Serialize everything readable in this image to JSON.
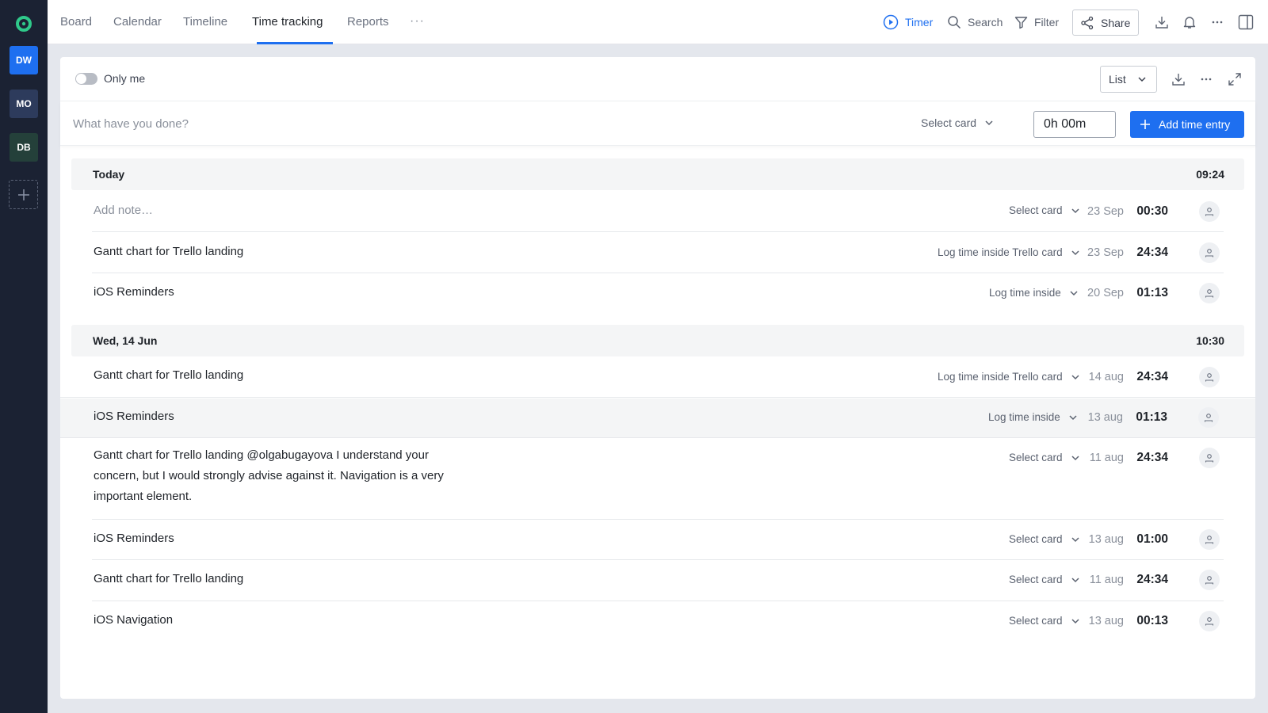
{
  "sidebar": {
    "workspaces": [
      {
        "initials": "DW",
        "color": "#1e6ff0"
      },
      {
        "initials": "MO",
        "color": "#2d3b5c"
      },
      {
        "initials": "DB",
        "color": "#24403a"
      }
    ]
  },
  "nav": {
    "tabs": [
      "Board",
      "Calendar",
      "Timeline",
      "Time tracking",
      "Reports"
    ],
    "active_tab": "Time tracking",
    "more": "···"
  },
  "topbar": {
    "timer_label": "Timer",
    "search_label": "Search",
    "filter_label": "Filter",
    "share_label": "Share"
  },
  "toolbar": {
    "only_me_label": "Only me",
    "view_mode": "List"
  },
  "entry": {
    "placeholder": "What have you done?",
    "select_card_label": "Select card",
    "duration_value": "0h 00m",
    "add_button_label": "Add time entry"
  },
  "groups": [
    {
      "title": "Today",
      "total": "09:24",
      "rows": [
        {
          "title": "Add note…",
          "card_select": "Select card",
          "date": "23 Sep",
          "duration": "00:30"
        },
        {
          "title": "Gantt chart for Trello landing",
          "card_select": "Log time inside Trello card",
          "date": "23 Sep",
          "duration": "24:34"
        },
        {
          "title": "iOS Reminders",
          "card_select": "Log time inside",
          "date": "20 Sep",
          "duration": "01:13"
        }
      ]
    },
    {
      "title": "Wed, 14 Jun",
      "total": "10:30",
      "rows": [
        {
          "title": "Gantt chart for Trello landing",
          "card_select": "Log time inside Trello card",
          "date": "14 aug",
          "duration": "24:34"
        },
        {
          "title": "iOS Reminders",
          "card_select": "Log time inside",
          "date": "13 aug",
          "duration": "01:13"
        },
        {
          "title": "Gantt chart for Trello landing @olgabugayova  I understand your concern, but I would strongly advise against it.  Navigation is a very important element.",
          "card_select": "Select card",
          "date": "11 aug",
          "duration": "24:34"
        },
        {
          "title": "iOS Reminders",
          "card_select": "Select card",
          "date": "13 aug",
          "duration": "01:00"
        },
        {
          "title": "Gantt chart for Trello landing",
          "card_select": "Select card",
          "date": "11 aug",
          "duration": "24:34"
        },
        {
          "title": "iOS Navigation",
          "card_select": "Select card",
          "date": "13 aug",
          "duration": "00:13"
        }
      ]
    }
  ],
  "colors": {
    "accent": "#1e6ff0",
    "sidebar": "#1b2233",
    "logo": "#2fc98a"
  }
}
